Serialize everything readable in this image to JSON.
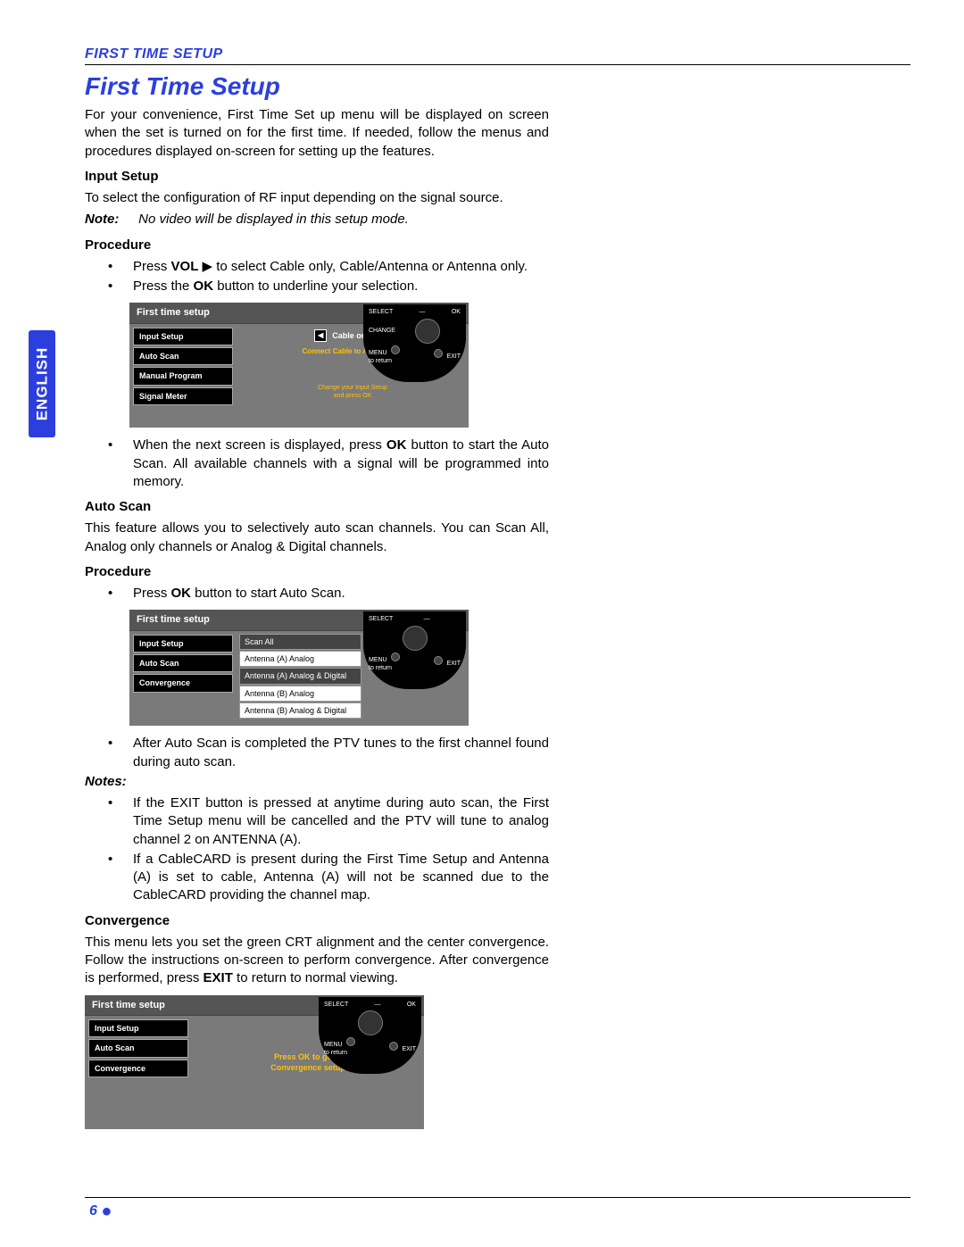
{
  "header_small": "FIRST TIME SETUP",
  "title": "First Time Setup",
  "side_tab": "ENGLISH",
  "page_num": "6",
  "intro": "For your convenience, First Time Set up menu will be displayed on screen when the set is turned on for the first time. If needed, follow the menus and procedures displayed on-screen for setting up the features.",
  "input_setup": {
    "heading": "Input Setup",
    "body": "To select the configuration of RF input depending on the signal source.",
    "note_label": "Note:",
    "note_text": "No video will be displayed in this setup mode.",
    "procedure_label": "Procedure",
    "step1a": "Press ",
    "step1_vol": "VOL",
    "step1b": " ▶ to select Cable only, Cable/Antenna or Antenna only.",
    "step2a": "Press the ",
    "step2_ok": "OK",
    "step2b": " button to underline your selection.",
    "step3a": "When the next screen is displayed, press ",
    "step3_ok": "OK",
    "step3b": " button to start the Auto Scan. All available channels with a signal will be programmed into memory."
  },
  "osd1": {
    "title": "First time setup",
    "menu": [
      "Input Setup",
      "Auto Scan",
      "Manual Program",
      "Signal Meter"
    ],
    "spin_value": "Cable only",
    "hint1": "Connect Cable to Antenna (A)",
    "hint2a": "Change your Input Setup",
    "hint2b": "and press OK",
    "remote": {
      "select": "SELECT",
      "ok": "OK",
      "change": "CHANGE",
      "menu": "MENU",
      "return": "to return",
      "exit": "EXIT"
    }
  },
  "auto_scan": {
    "heading": "Auto Scan",
    "body": "This feature allows you to selectively auto scan channels. You can Scan All, Analog only channels or Analog & Digital channels.",
    "procedure_label": "Procedure",
    "step1a": "Press ",
    "step1_ok": "OK",
    "step1b": " button to start Auto Scan.",
    "step2": "After Auto Scan is completed the PTV tunes to the first channel found during auto scan."
  },
  "osd2": {
    "title": "First time setup",
    "menu": [
      "Input Setup",
      "Auto Scan",
      "Convergence"
    ],
    "list": [
      "Scan All",
      "Antenna (A) Analog",
      "Antenna (A) Analog & Digital",
      "Antenna (B) Analog",
      "Antenna (B) Analog & Digital"
    ],
    "remote": {
      "select": "SELECT",
      "menu": "MENU",
      "return": "to return",
      "exit": "EXIT"
    }
  },
  "notes_section": {
    "label": "Notes:",
    "n1": "If the EXIT button is pressed at anytime during auto scan, the First Time Setup menu will be cancelled and the PTV will tune to analog channel 2 on ANTENNA (A).",
    "n2": "If a CableCARD is present during the First Time Setup and Antenna (A) is set to cable, Antenna (A) will not be scanned due to the CableCARD providing the channel map."
  },
  "convergence": {
    "heading": "Convergence",
    "body1": "This menu lets you set the green CRT alignment and the center convergence. Follow the instructions on-screen to perform convergence. After convergence is performed, press ",
    "exit": "EXIT",
    "body2": " to return to normal viewing."
  },
  "osd3": {
    "title": "First time setup",
    "menu": [
      "Input Setup",
      "Auto Scan",
      "Convergence"
    ],
    "hint1": "Press OK to go to",
    "hint2": "Convergence setup",
    "remote": {
      "select": "SELECT",
      "ok": "OK",
      "menu": "MENU",
      "return": "to return",
      "exit": "EXIT"
    }
  }
}
